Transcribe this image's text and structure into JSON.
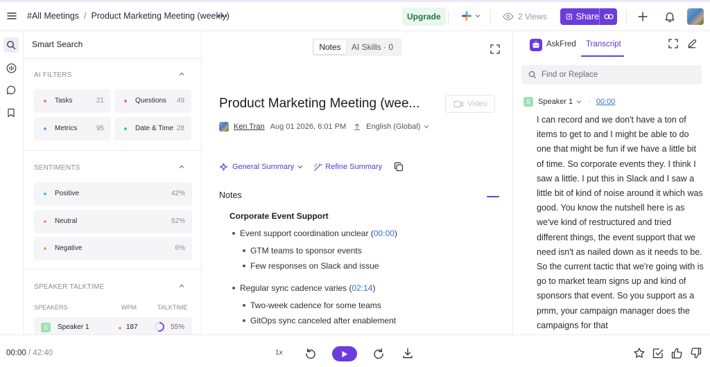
{
  "header": {
    "workspace": "#All Meetings",
    "separator": "/",
    "meeting_title": "Product Marketing Meeting (weekly)",
    "upgrade_label": "Upgrade",
    "views_label": "2 Views",
    "share_label": "Share"
  },
  "filters": {
    "smart_search": "Smart Search",
    "ai_filters": {
      "title": "AI FILTERS",
      "items": [
        {
          "label": "Tasks",
          "count": "21",
          "color": "#f08a5d"
        },
        {
          "label": "Questions",
          "count": "49",
          "color": "#e86aa6"
        },
        {
          "label": "Metrics",
          "count": "95",
          "color": "#5aa6e8"
        },
        {
          "label": "Date & Time",
          "count": "28",
          "color": "#3cc2a0"
        }
      ]
    },
    "sentiments": {
      "title": "SENTIMENTS",
      "items": [
        {
          "label": "Positive",
          "value": "42%",
          "color": "#45c6d8"
        },
        {
          "label": "Neutral",
          "value": "52%",
          "color": "#f08aa8"
        },
        {
          "label": "Negative",
          "value": "6%",
          "color": "#f0a05d"
        }
      ]
    },
    "talktime": {
      "title": "SPEAKER TALKTIME",
      "col_speakers": "SPEAKERS",
      "col_wpm": "WPM",
      "col_talktime": "TALKTIME",
      "rows": [
        {
          "initial": "S",
          "name": "Speaker 1",
          "wpm": "187",
          "talktime": "55%",
          "talktime_fraction": 0.55
        }
      ]
    }
  },
  "main": {
    "tab_notes": "Notes",
    "tab_ai_skills": "AI Skills · 0",
    "title": "Product Marketing Meeting (wee...",
    "video_label": "Video",
    "owner": "Ken Tran",
    "date": "Aug 01 2026, 6:01 PM",
    "language": "English (Global)",
    "summary_label": "General Summary",
    "refine_label": "Refine Summary",
    "notes_heading": "Notes",
    "section_heading": "Corporate Event Support",
    "bullets": [
      {
        "text": "Event support coordination unclear (",
        "time": "00:00",
        "close": ")"
      },
      {
        "text": "GTM teams to sponsor events"
      },
      {
        "text": "Few responses on Slack and issue"
      },
      {
        "text": "Regular sync cadence varies (",
        "time": "02:14",
        "close": ")"
      },
      {
        "text": "Two-week cadence for some teams"
      },
      {
        "text": "GitOps sync canceled after enablement"
      }
    ]
  },
  "transcript": {
    "askfred_label": "AskFred",
    "transcript_tab": "Transcript",
    "find_placeholder": "Find or Replace",
    "speaker_initial": "S",
    "speaker_name": "Speaker 1",
    "timestamp": "00:00",
    "text": "I can record and we don't have a ton of items to get to and I might be able to do one that might be fun if we have a little bit of time. So corporate events they. I think I saw a little. I put this in Slack and I saw a little bit of kind of noise around it which was good. You know the nutshell here is as we've kind of restructured and tried different things, the event support that we need isn't as nailed down as it needs to be. So the current tactic that we're going with is go to market team signs up and kind of sponsors that event. So you support as a pmm, your campaign manager does the campaigns for that"
  },
  "player": {
    "current_time": "00:00",
    "total_time": "/ 42:40",
    "speed": "1x"
  },
  "colors": {
    "accent": "#6a3ddb",
    "link": "#3a6fc9",
    "upgrade_bg": "#eaf6ef",
    "upgrade_text": "#1f7a45"
  }
}
